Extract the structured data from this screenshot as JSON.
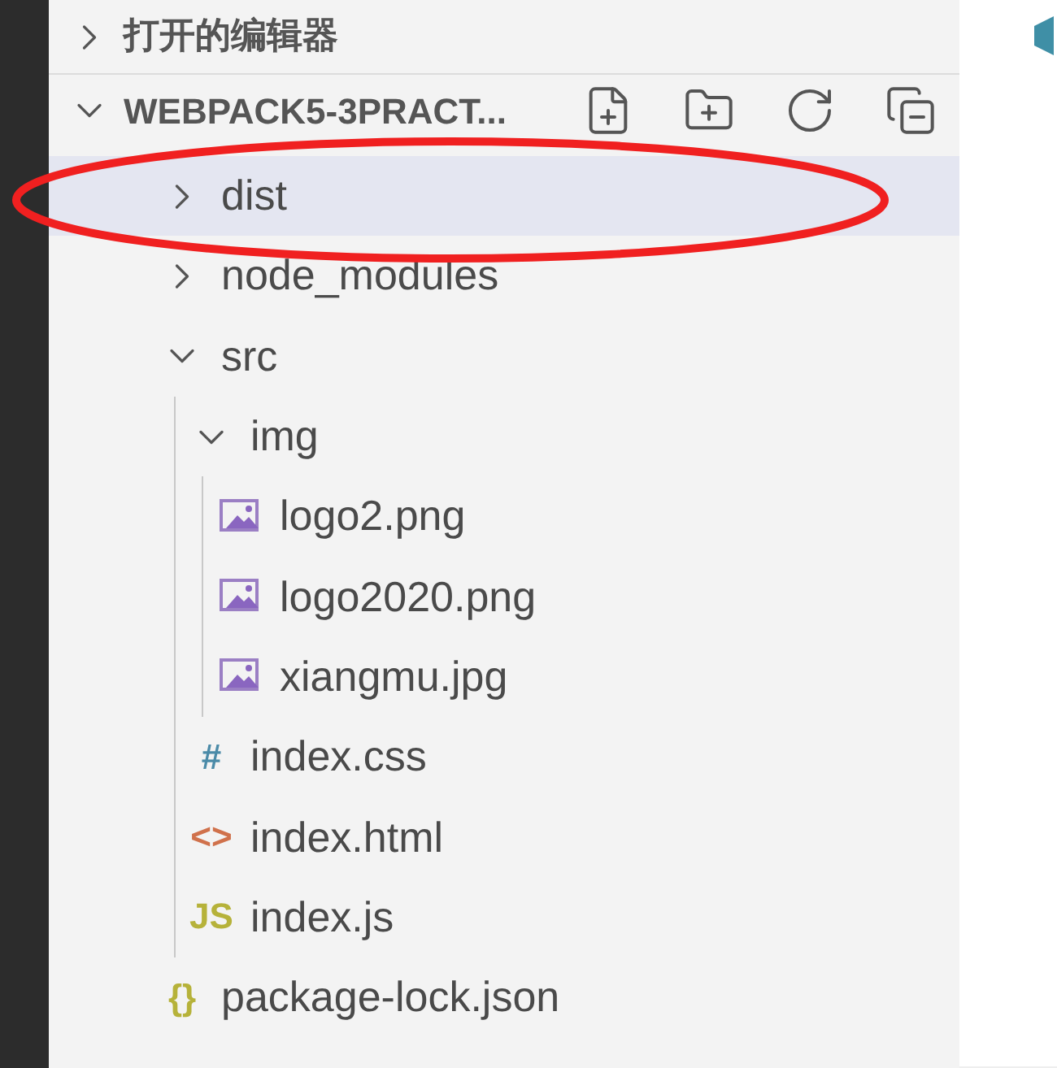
{
  "open_editors": {
    "title": "打开的编辑器",
    "expanded": false
  },
  "project": {
    "title": "WEBPACK5-3PRACT...",
    "expanded": true
  },
  "tree": [
    {
      "kind": "folder",
      "name": "dist",
      "expanded": false,
      "selected": true
    },
    {
      "kind": "folder",
      "name": "node_modules",
      "expanded": false,
      "selected": false
    },
    {
      "kind": "folder",
      "name": "src",
      "expanded": true,
      "selected": false,
      "children": [
        {
          "kind": "folder",
          "name": "img",
          "expanded": true,
          "selected": false,
          "children": [
            {
              "kind": "image",
              "name": "logo2.png",
              "selected": false
            },
            {
              "kind": "image",
              "name": "logo2020.png",
              "selected": false
            },
            {
              "kind": "image",
              "name": "xiangmu.jpg",
              "selected": false
            }
          ]
        },
        {
          "kind": "css",
          "glyph": "#",
          "name": "index.css",
          "selected": false
        },
        {
          "kind": "html",
          "glyph": "<>",
          "name": "index.html",
          "selected": false
        },
        {
          "kind": "js",
          "glyph": "JS",
          "name": "index.js",
          "selected": false
        }
      ]
    },
    {
      "kind": "json",
      "glyph": "{}",
      "name": "package-lock.json",
      "selected": false
    }
  ]
}
